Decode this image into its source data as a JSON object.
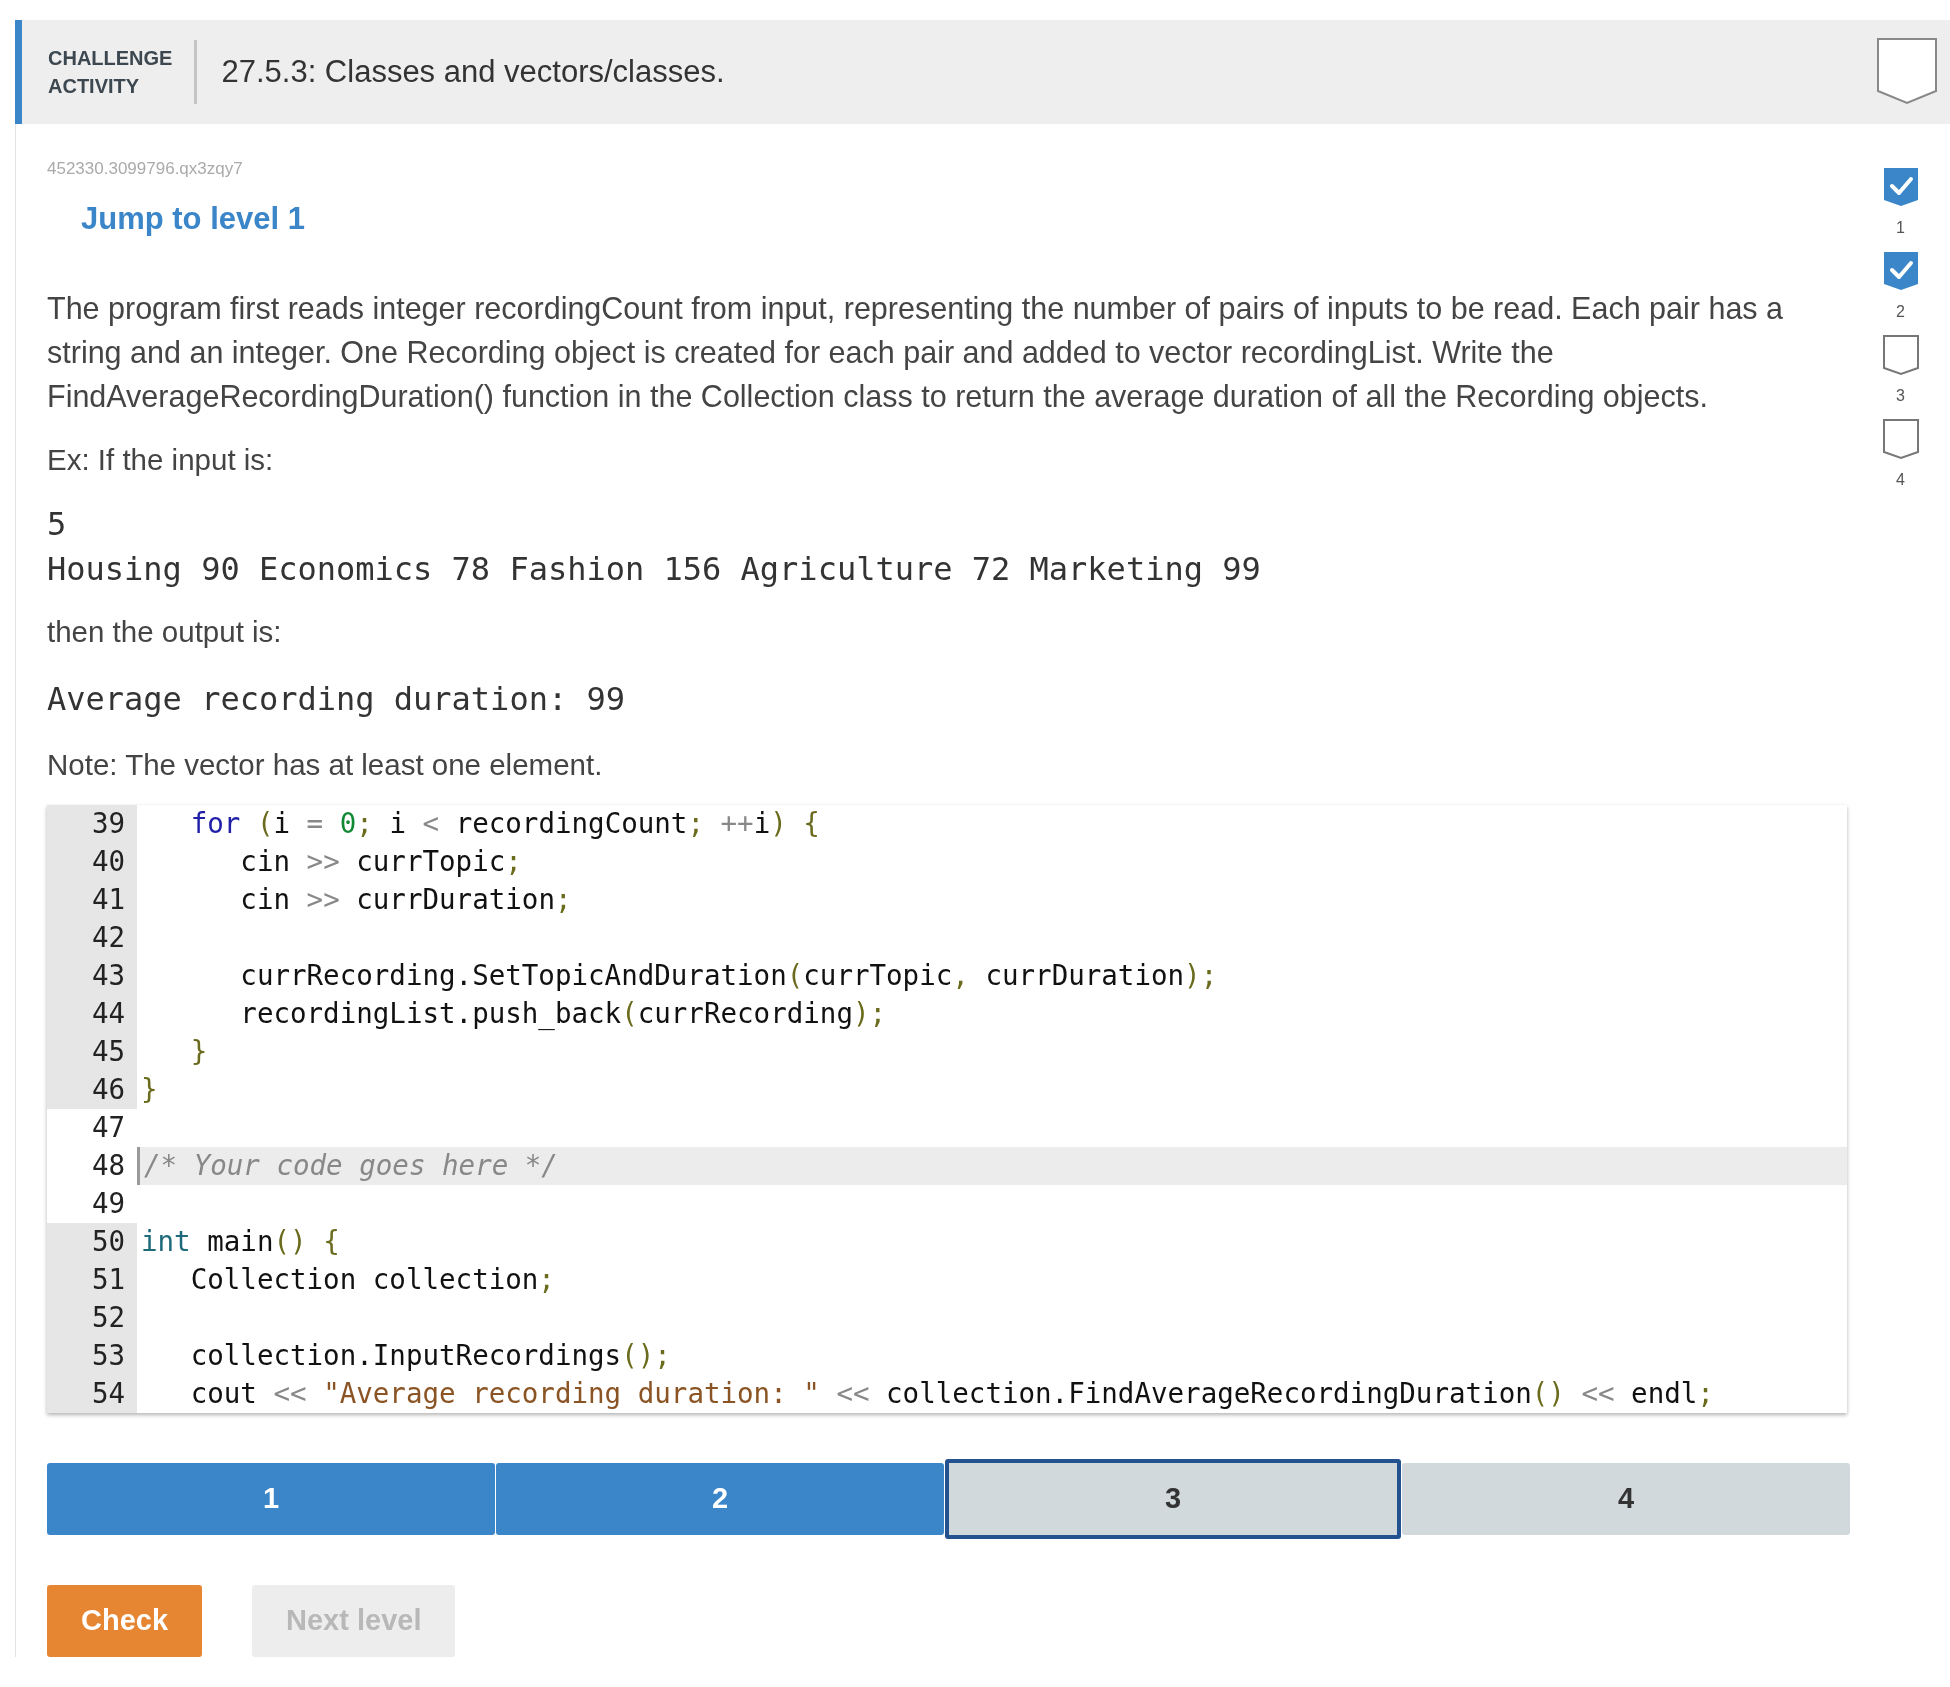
{
  "header": {
    "label_line_1": "CHALLENGE",
    "label_line_2": "ACTIVITY",
    "title": "27.5.3: Classes and vectors/classes.",
    "completed": false
  },
  "activity_id": "452330.3099796.qx3zqy7",
  "jump_link": "Jump to level 1",
  "level_markers": [
    {
      "label": "1",
      "completed": true
    },
    {
      "label": "2",
      "completed": true
    },
    {
      "label": "3",
      "completed": false
    },
    {
      "label": "4",
      "completed": false
    }
  ],
  "description": "The program first reads integer recordingCount from input, representing the number of pairs of inputs to be read. Each pair has a string and an integer. One Recording object is created for each pair and added to vector recordingList. Write the FindAverageRecordingDuration() function in the Collection class to return the average duration of all the Recording objects.",
  "example_intro": "Ex: If the input is:",
  "example_input": [
    "5",
    "Housing 90 Economics 78 Fashion 156 Agriculture 72 Marketing 99"
  ],
  "output_intro": "then the output is:",
  "example_output": "Average recording duration: 99",
  "note": "Note: The vector has at least one element.",
  "code_lines": [
    {
      "number": "39",
      "read_only": true,
      "active": false,
      "tokens": [
        {
          "kind": "keyword",
          "text": "   for"
        },
        {
          "kind": "punct",
          "text": " ("
        },
        {
          "kind": "plain",
          "text": "i "
        },
        {
          "kind": "op",
          "text": "= "
        },
        {
          "kind": "number",
          "text": "0"
        },
        {
          "kind": "punct",
          "text": ";"
        },
        {
          "kind": "plain",
          "text": " i "
        },
        {
          "kind": "op",
          "text": "<"
        },
        {
          "kind": "plain",
          "text": " recordingCount"
        },
        {
          "kind": "punct",
          "text": "; "
        },
        {
          "kind": "op",
          "text": "++"
        },
        {
          "kind": "plain",
          "text": "i"
        },
        {
          "kind": "punct",
          "text": ") {"
        }
      ]
    },
    {
      "number": "40",
      "read_only": true,
      "active": false,
      "tokens": [
        {
          "kind": "plain",
          "text": "      cin "
        },
        {
          "kind": "op",
          "text": ">>"
        },
        {
          "kind": "plain",
          "text": " currTopic"
        },
        {
          "kind": "punct",
          "text": ";"
        }
      ]
    },
    {
      "number": "41",
      "read_only": true,
      "active": false,
      "tokens": [
        {
          "kind": "plain",
          "text": "      cin "
        },
        {
          "kind": "op",
          "text": ">>"
        },
        {
          "kind": "plain",
          "text": " currDuration"
        },
        {
          "kind": "punct",
          "text": ";"
        }
      ]
    },
    {
      "number": "42",
      "read_only": true,
      "active": false
    },
    {
      "number": "43",
      "read_only": true,
      "active": false,
      "tokens": [
        {
          "kind": "plain",
          "text": "      currRecording.SetTopicAndDuration"
        },
        {
          "kind": "punct",
          "text": "("
        },
        {
          "kind": "plain",
          "text": "currTopic"
        },
        {
          "kind": "punct",
          "text": ","
        },
        {
          "kind": "plain",
          "text": " currDuration"
        },
        {
          "kind": "punct",
          "text": ");"
        }
      ]
    },
    {
      "number": "44",
      "read_only": true,
      "active": false,
      "tokens": [
        {
          "kind": "plain",
          "text": "      recordingList.push_back"
        },
        {
          "kind": "punct",
          "text": "("
        },
        {
          "kind": "plain",
          "text": "currRecording"
        },
        {
          "kind": "punct",
          "text": ");"
        }
      ]
    },
    {
      "number": "45",
      "read_only": true,
      "active": false,
      "tokens": [
        {
          "kind": "punct",
          "text": "   }"
        }
      ]
    },
    {
      "number": "46",
      "read_only": true,
      "active": false,
      "tokens": [
        {
          "kind": "punct",
          "text": "}"
        }
      ]
    },
    {
      "number": "47",
      "read_only": false,
      "active": false
    },
    {
      "number": "48",
      "read_only": false,
      "active": true,
      "tokens": [
        {
          "kind": "comment",
          "text": "/* Your code goes here */"
        }
      ]
    },
    {
      "number": "49",
      "read_only": false,
      "active": false
    },
    {
      "number": "50",
      "read_only": true,
      "active": false,
      "tokens": [
        {
          "kind": "type",
          "text": "int"
        },
        {
          "kind": "plain",
          "text": " main"
        },
        {
          "kind": "punct",
          "text": "() {"
        }
      ]
    },
    {
      "number": "51",
      "read_only": true,
      "active": false,
      "tokens": [
        {
          "kind": "plain",
          "text": "   Collection collection"
        },
        {
          "kind": "punct",
          "text": ";"
        }
      ]
    },
    {
      "number": "52",
      "read_only": true,
      "active": false
    },
    {
      "number": "53",
      "read_only": true,
      "active": false,
      "tokens": [
        {
          "kind": "plain",
          "text": "   collection.InputRecordings"
        },
        {
          "kind": "punct",
          "text": "();"
        }
      ]
    },
    {
      "number": "54",
      "read_only": true,
      "active": false,
      "tokens": [
        {
          "kind": "plain",
          "text": "   cout "
        },
        {
          "kind": "op",
          "text": "<<"
        },
        {
          "kind": "string",
          "text": " \"Average recording duration: \""
        },
        {
          "kind": "op",
          "text": " <<"
        },
        {
          "kind": "plain",
          "text": " collection.FindAverageRecordingDuration"
        },
        {
          "kind": "punct",
          "text": "()"
        },
        {
          "kind": "op",
          "text": " <<"
        },
        {
          "kind": "plain",
          "text": " endl"
        },
        {
          "kind": "punct",
          "text": ";"
        }
      ]
    }
  ],
  "levels": [
    {
      "label": "1",
      "completed": true,
      "selected": false
    },
    {
      "label": "2",
      "completed": true,
      "selected": false
    },
    {
      "label": "3",
      "completed": false,
      "selected": true
    },
    {
      "label": "4",
      "completed": false,
      "selected": false
    }
  ],
  "buttons": [
    {
      "label": "Check",
      "disabled": false
    },
    {
      "label": "Next level",
      "disabled": true
    }
  ]
}
